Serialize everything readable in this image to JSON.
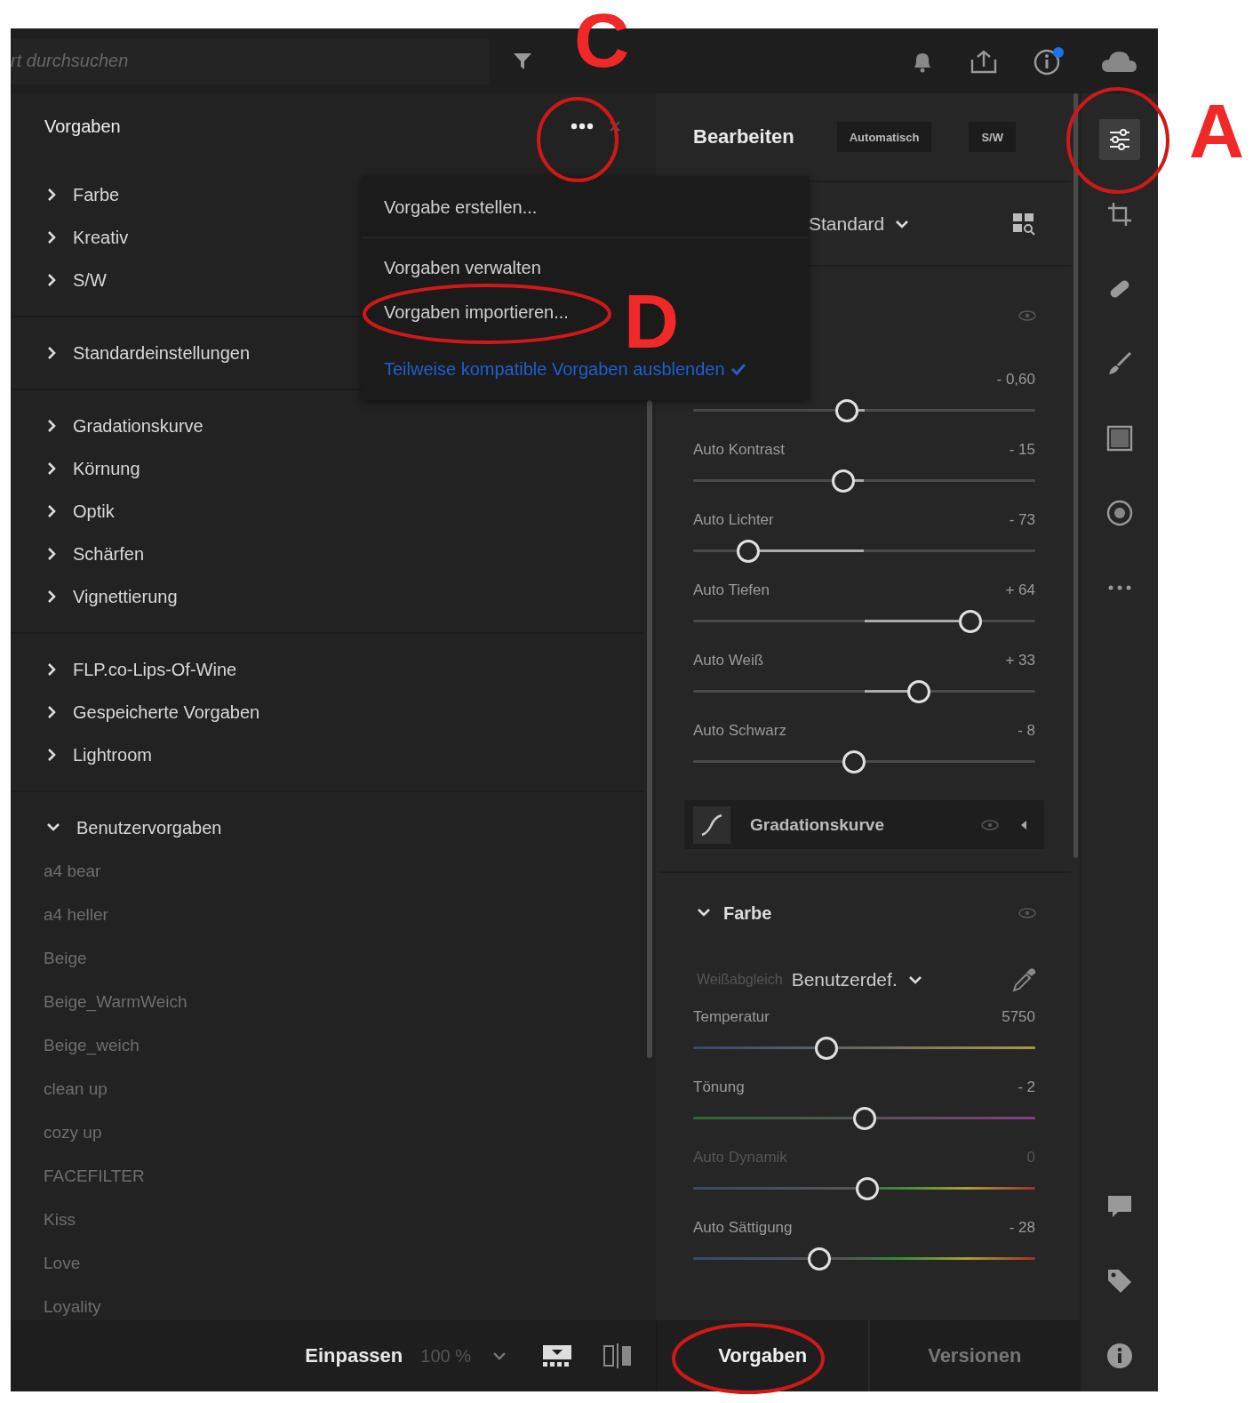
{
  "top_bar": {
    "search": {
      "placeholder": "rt durchsuchen"
    }
  },
  "presets_panel": {
    "title": "Vorgaben",
    "groups": [
      [
        {
          "label": "Farbe",
          "expanded": false
        },
        {
          "label": "Kreativ",
          "expanded": false
        },
        {
          "label": "S/W",
          "expanded": false
        }
      ],
      [
        {
          "label": "Standardeinstellungen",
          "expanded": false
        }
      ],
      [
        {
          "label": "Gradationskurve",
          "expanded": false
        },
        {
          "label": "Körnung",
          "expanded": false
        },
        {
          "label": "Optik",
          "expanded": false
        },
        {
          "label": "Schärfen",
          "expanded": false
        },
        {
          "label": "Vignettierung",
          "expanded": false
        }
      ],
      [
        {
          "label": "FLP.co-Lips-Of-Wine",
          "expanded": false
        },
        {
          "label": "Gespeicherte Vorgaben",
          "expanded": false
        },
        {
          "label": "Lightroom",
          "expanded": false
        }
      ],
      [
        {
          "label": "Benutzervorgaben",
          "expanded": true,
          "children": [
            "a4 bear",
            "a4 heller",
            "Beige",
            "Beige_WarmWeich",
            "Beige_weich",
            "clean up",
            "cozy up",
            "FACEFILTER",
            "Kiss",
            "Love",
            "Loyality"
          ]
        }
      ]
    ]
  },
  "preset_menu": {
    "items": [
      {
        "label": "Vorgabe erstellen...",
        "kind": "action"
      },
      {
        "label": "Vorgaben verwalten",
        "kind": "action"
      },
      {
        "label": "Vorgaben importieren...",
        "kind": "action"
      },
      {
        "label": "Teilweise kompatible Vorgaben ausblenden",
        "kind": "toggle",
        "checked": true
      }
    ]
  },
  "edit_panel": {
    "title": "Bearbeiten",
    "buttons": [
      "Automatisch",
      "S/W"
    ],
    "profile": "Standard",
    "light_sliders": [
      {
        "value": "- 0,60",
        "level": 0.45
      },
      {
        "label": "Auto Kontrast",
        "value": "- 15",
        "level": 0.44
      },
      {
        "label": "Auto Lichter",
        "value": "- 73",
        "level": 0.16
      },
      {
        "label": "Auto Tiefen",
        "value": "+ 64",
        "level": 0.81
      },
      {
        "label": "Auto Weiß",
        "value": "+ 33",
        "level": 0.66
      },
      {
        "label": "Auto Schwarz",
        "value": "- 8",
        "level": 0.47
      }
    ],
    "tone_curve": {
      "label": "Gradationskurve",
      "expanded": false
    },
    "color_section": {
      "title": "Farbe",
      "expanded": true,
      "white_balance_label": "Weißabgleich",
      "white_balance": "Benutzerdef.",
      "sliders": [
        {
          "kind": "temperature",
          "label": "Temperatur",
          "value": "5750",
          "level": 0.39,
          "disabled": false
        },
        {
          "kind": "tint",
          "label": "Tönung",
          "value": "- 2",
          "level": 0.5,
          "disabled": false
        },
        {
          "kind": "saturation",
          "label": "Auto Dynamik",
          "value": "0",
          "level": 0.51,
          "disabled": true
        },
        {
          "kind": "saturation",
          "label": "Auto Sättigung",
          "value": "- 28",
          "level": 0.37,
          "disabled": false
        }
      ]
    }
  },
  "tool_strip": {
    "tools": [
      {
        "kind": "sliders",
        "selected": true
      },
      {
        "kind": "crop",
        "selected": false
      },
      {
        "kind": "bandage",
        "selected": false
      },
      {
        "kind": "brush",
        "selected": false
      },
      {
        "kind": "linear",
        "selected": false
      },
      {
        "kind": "radial",
        "selected": false
      },
      {
        "kind": "more",
        "selected": false
      }
    ],
    "bottom_tools": [
      {
        "kind": "comment"
      },
      {
        "kind": "tag"
      },
      {
        "kind": "info"
      }
    ]
  },
  "bottom_bar": {
    "zoom_mode": "Einpassen",
    "zoom_level": "100 %",
    "tabs": [
      {
        "label": "Vorgaben",
        "selected": true
      },
      {
        "label": "Versionen",
        "selected": false
      }
    ]
  },
  "annotations": {
    "letters": [
      "C",
      "D",
      "A"
    ]
  }
}
